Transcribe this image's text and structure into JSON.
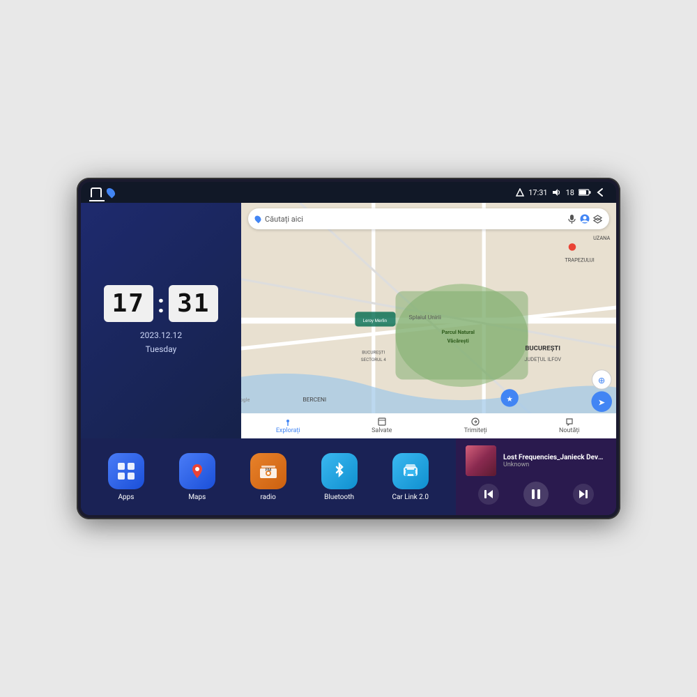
{
  "device": {
    "screen_bg": "#1e2a5e"
  },
  "status_bar": {
    "time": "17:31",
    "signal_icon": "signal",
    "volume_icon": "volume",
    "battery_value": "18",
    "battery_icon": "battery",
    "back_icon": "back-arrow"
  },
  "clock": {
    "hour": "17",
    "minute": "31",
    "date": "2023.12.12",
    "day": "Tuesday"
  },
  "map": {
    "search_placeholder": "Căutați aici",
    "locations": [
      "Parcul Natural Văcărești",
      "Leroy Merlin",
      "BUCUREȘTI",
      "JUDEȚUL ILFOV",
      "BERCENI",
      "TRAPEZULUI",
      "UZANA"
    ],
    "nav_items": [
      {
        "label": "Explorați",
        "active": true
      },
      {
        "label": "Salvate",
        "active": false
      },
      {
        "label": "Trimiteți",
        "active": false
      },
      {
        "label": "Noutăți",
        "active": false
      }
    ]
  },
  "apps": [
    {
      "id": "apps",
      "label": "Apps",
      "icon_type": "apps"
    },
    {
      "id": "maps",
      "label": "Maps",
      "icon_type": "maps"
    },
    {
      "id": "radio",
      "label": "radio",
      "icon_type": "radio"
    },
    {
      "id": "bluetooth",
      "label": "Bluetooth",
      "icon_type": "bluetooth"
    },
    {
      "id": "carlink",
      "label": "Car Link 2.0",
      "icon_type": "carlink"
    }
  ],
  "music": {
    "title": "Lost Frequencies_Janieck Devy-...",
    "artist": "Unknown",
    "controls": {
      "prev": "⏮",
      "play": "⏸",
      "next": "⏭"
    }
  }
}
